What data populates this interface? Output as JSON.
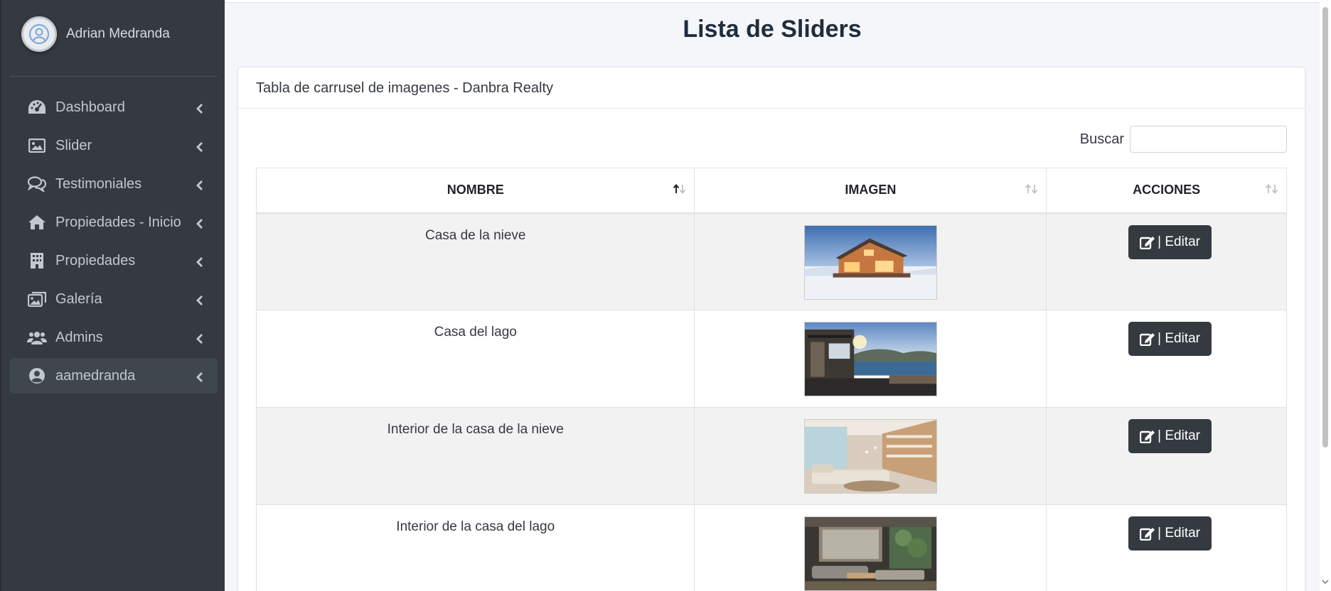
{
  "sidebar": {
    "user_name": "Adrian Medranda",
    "items": [
      {
        "label": "Dashboard",
        "icon": "tachometer-icon"
      },
      {
        "label": "Slider",
        "icon": "image-icon"
      },
      {
        "label": "Testimoniales",
        "icon": "comments-icon"
      },
      {
        "label": "Propiedades - Inicio",
        "icon": "home-icon"
      },
      {
        "label": "Propiedades",
        "icon": "building-icon"
      },
      {
        "label": "Galería",
        "icon": "images-icon"
      },
      {
        "label": "Admins",
        "icon": "users-icon"
      },
      {
        "label": "aamedranda",
        "icon": "user-circle-icon",
        "active": true
      }
    ]
  },
  "page": {
    "title": "Lista de Sliders"
  },
  "card": {
    "header": "Tabla de carrusel de imagenes - Danbra Realty"
  },
  "search": {
    "label": "Buscar",
    "value": ""
  },
  "table": {
    "columns": [
      "NOMBRE",
      "IMAGEN",
      "ACCIONES"
    ],
    "sorted_column": "NOMBRE",
    "sort_direction": "ascending",
    "rows": [
      {
        "name": "Casa de la nieve",
        "image": "snow-house-photo"
      },
      {
        "name": "Casa del lago",
        "image": "lake-house-photo"
      },
      {
        "name": "Interior de la casa de la nieve",
        "image": "snow-house-interior-photo"
      },
      {
        "name": "Interior de la casa del lago",
        "image": "lake-house-interior-photo"
      }
    ],
    "edit_label": "| Editar"
  },
  "colors": {
    "sidebar_bg": "#343a40",
    "button_bg": "#343a40",
    "page_bg": "#f4f6f9"
  }
}
